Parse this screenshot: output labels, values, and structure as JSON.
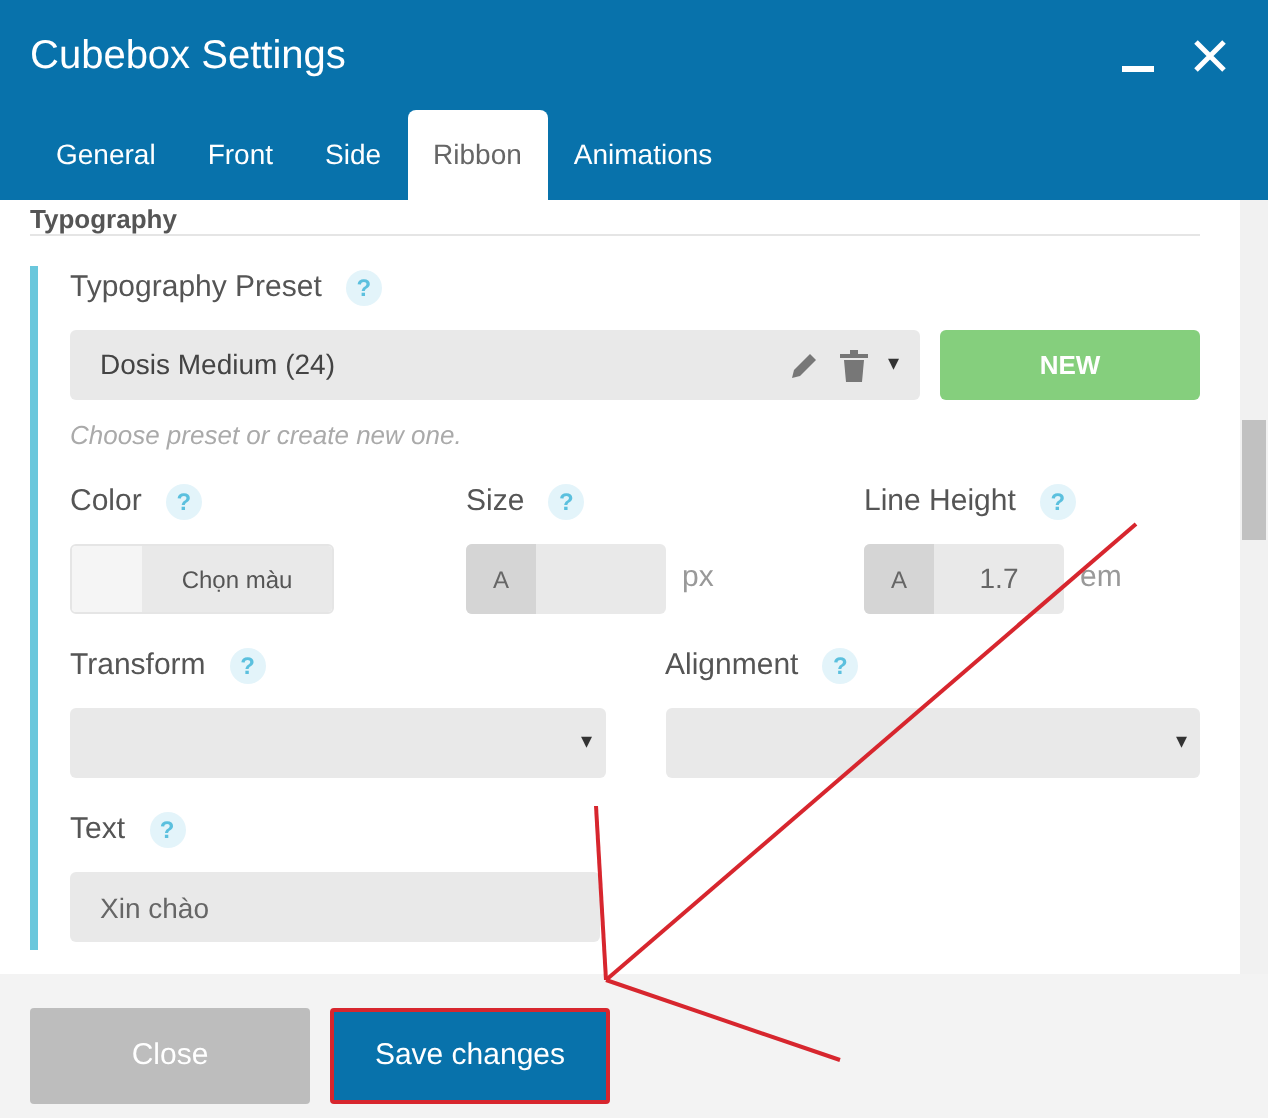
{
  "window": {
    "title": "Cubebox Settings"
  },
  "tabs": [
    {
      "label": "General",
      "selected": false
    },
    {
      "label": "Front",
      "selected": false
    },
    {
      "label": "Side",
      "selected": false
    },
    {
      "label": "Ribbon",
      "selected": true
    },
    {
      "label": "Animations",
      "selected": false
    }
  ],
  "section": {
    "title": "Typography"
  },
  "preset": {
    "label": "Typography Preset",
    "help": "?",
    "value": "Dosis Medium (24)",
    "caret": "▾",
    "new_button": "NEW",
    "hint": "Choose preset or create new one."
  },
  "color": {
    "label": "Color",
    "help": "?",
    "button": "Chọn màu"
  },
  "size": {
    "label": "Size",
    "help": "?",
    "prefix": "A",
    "unit": "px"
  },
  "line_height": {
    "label": "Line Height",
    "help": "?",
    "prefix": "A",
    "value": "1.7",
    "unit": "em"
  },
  "selects": [
    {
      "label": "Transform",
      "help": "?",
      "caret": "▾"
    },
    {
      "label": "Alignment",
      "help": "?",
      "caret": "▾"
    }
  ],
  "text": {
    "label": "Text",
    "help": "?",
    "value": "Xin chào"
  },
  "buttons": [
    {
      "label": "Close",
      "kind": "secondary",
      "highlighted": false
    },
    {
      "label": "Save changes",
      "kind": "primary",
      "highlighted": true
    }
  ]
}
